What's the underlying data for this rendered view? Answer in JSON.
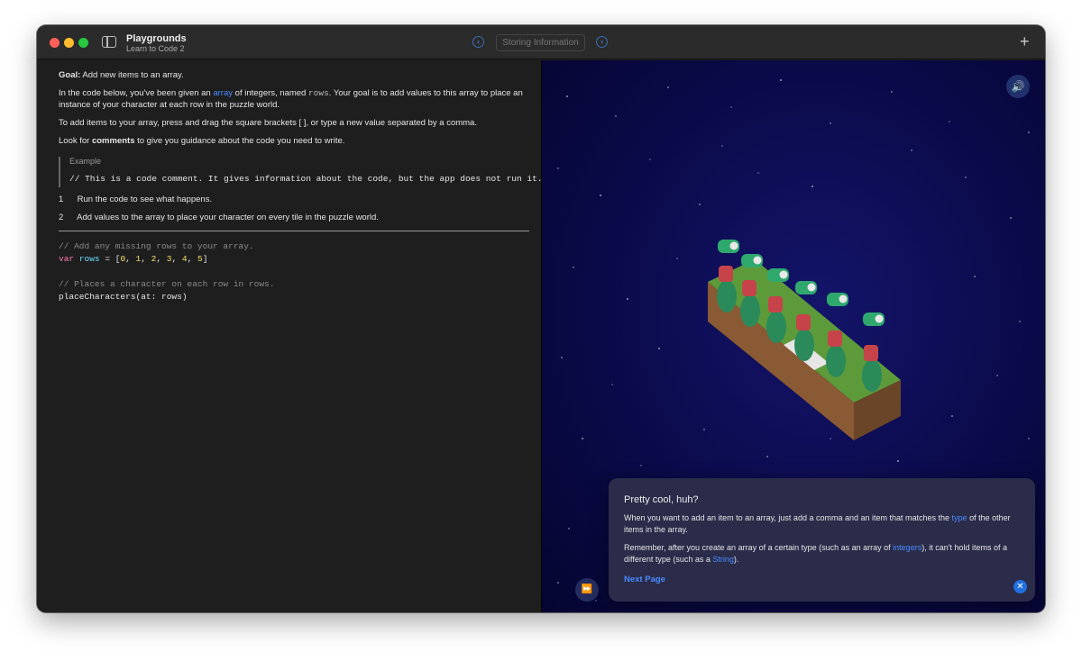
{
  "titlebar": {
    "app_title": "Playgrounds",
    "app_subtitle": "Learn to Code 2",
    "page_title": "Storing Information",
    "prev_icon": "chevron-left-icon",
    "next_icon": "chevron-right-icon",
    "add_icon": "plus-icon",
    "add_symbol": "+"
  },
  "instructions": {
    "goal_label": "Goal:",
    "goal_text": "Add new items to an array.",
    "p1_a": "In the code below, you've been given an",
    "p1_link": "array",
    "p1_b": "of integers, named",
    "p1_code": "rows",
    "p1_c": ". Your goal is to add values to this array to place an",
    "p1_d": "instance of your character at each row in the puzzle world.",
    "p2": "To add items to your array, press and drag the square brackets [ ], or type a new value separated by a comma.",
    "p3_a": "Look for",
    "p3_bold": "comments",
    "p3_b": "to give you guidance about the code you need to write.",
    "example_label": "Example",
    "example_code": "// This is a code comment. It gives information about the code, but the app does not run it.",
    "steps": [
      {
        "num": "1",
        "text": "Run the code to see what happens."
      },
      {
        "num": "2",
        "text": "Add values to the array to place your character on every tile in the puzzle world."
      }
    ]
  },
  "code": {
    "comment1": "// Add any missing rows to your array.",
    "kw": "var",
    "var_name": "rows",
    "assign": " = [",
    "numbers": [
      "0",
      "1",
      "2",
      "3",
      "4",
      "5"
    ],
    "close": "]",
    "comment2": "// Places a character on each row in rows.",
    "call": "placeCharacters(at: rows)"
  },
  "scene": {
    "speaker_icon": "speaker-icon",
    "fast_forward_icon": "fast-forward-icon",
    "speaker_glyph": "🔊",
    "ff_glyph": "⏩",
    "character_count": 6
  },
  "card": {
    "title": "Pretty cool, huh?",
    "p1_a": "When you want to add an item to an array, just add a comma and an item that matches the",
    "p1_link": "type",
    "p1_b": "of the other items in the array.",
    "p2_a": "Remember, after you create an array of a certain type (such as an array of",
    "p2_link1": "integers",
    "p2_b": "), it can't hold items of a different type (such as a",
    "p2_link2": "String",
    "p2_c": ").",
    "next_label": "Next Page",
    "close_icon": "close-icon",
    "close_glyph": "✕"
  },
  "colors": {
    "accent": "#4a8bff",
    "scene_bg": "#0a0a4a",
    "code_keyword": "#ff7ab2",
    "code_var": "#6bdfff",
    "code_number": "#f4e06b"
  }
}
